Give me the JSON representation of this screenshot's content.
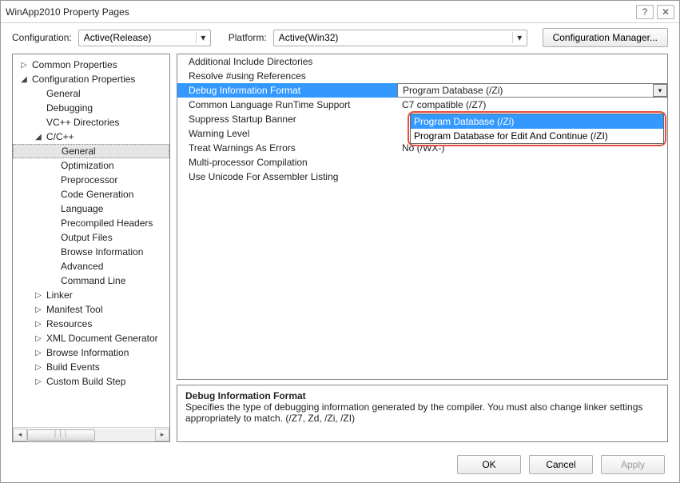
{
  "window": {
    "title": "WinApp2010 Property Pages"
  },
  "toolbar": {
    "config_label": "Configuration:",
    "config_value": "Active(Release)",
    "platform_label": "Platform:",
    "platform_value": "Active(Win32)",
    "manager_label": "Configuration Manager..."
  },
  "tree": {
    "items": [
      {
        "depth": 0,
        "exp": "▷",
        "label": "Common Properties"
      },
      {
        "depth": 0,
        "exp": "◢",
        "label": "Configuration Properties"
      },
      {
        "depth": 1,
        "exp": "",
        "label": "General"
      },
      {
        "depth": 1,
        "exp": "",
        "label": "Debugging"
      },
      {
        "depth": 1,
        "exp": "",
        "label": "VC++ Directories"
      },
      {
        "depth": 1,
        "exp": "◢",
        "label": "C/C++"
      },
      {
        "depth": 2,
        "exp": "",
        "label": "General",
        "selected": true
      },
      {
        "depth": 2,
        "exp": "",
        "label": "Optimization"
      },
      {
        "depth": 2,
        "exp": "",
        "label": "Preprocessor"
      },
      {
        "depth": 2,
        "exp": "",
        "label": "Code Generation"
      },
      {
        "depth": 2,
        "exp": "",
        "label": "Language"
      },
      {
        "depth": 2,
        "exp": "",
        "label": "Precompiled Headers"
      },
      {
        "depth": 2,
        "exp": "",
        "label": "Output Files"
      },
      {
        "depth": 2,
        "exp": "",
        "label": "Browse Information"
      },
      {
        "depth": 2,
        "exp": "",
        "label": "Advanced"
      },
      {
        "depth": 2,
        "exp": "",
        "label": "Command Line"
      },
      {
        "depth": 1,
        "exp": "▷",
        "label": "Linker"
      },
      {
        "depth": 1,
        "exp": "▷",
        "label": "Manifest Tool"
      },
      {
        "depth": 1,
        "exp": "▷",
        "label": "Resources"
      },
      {
        "depth": 1,
        "exp": "▷",
        "label": "XML Document Generator"
      },
      {
        "depth": 1,
        "exp": "▷",
        "label": "Browse Information"
      },
      {
        "depth": 1,
        "exp": "▷",
        "label": "Build Events"
      },
      {
        "depth": 1,
        "exp": "▷",
        "label": "Custom Build Step"
      }
    ]
  },
  "grid": {
    "rows": [
      {
        "name": "Additional Include Directories",
        "value": ""
      },
      {
        "name": "Resolve #using References",
        "value": ""
      },
      {
        "name": "Debug Information Format",
        "value": "Program Database (/Zi)",
        "selected": true
      },
      {
        "name": "Common Language RunTime Support",
        "value": "C7 compatible (/Z7)"
      },
      {
        "name": "Suppress Startup Banner",
        "value": ""
      },
      {
        "name": "Warning Level",
        "value": ""
      },
      {
        "name": "Treat Warnings As Errors",
        "value": "No (/WX-)"
      },
      {
        "name": "Multi-processor Compilation",
        "value": ""
      },
      {
        "name": "Use Unicode For Assembler Listing",
        "value": ""
      }
    ]
  },
  "dropdown": {
    "options": [
      {
        "label": "Program Database (/Zi)",
        "hi": true
      },
      {
        "label": "Program Database for Edit And Continue (/ZI)"
      }
    ]
  },
  "desc": {
    "title": "Debug Information Format",
    "body": "Specifies the type of debugging information generated by the compiler.  You must also change linker settings appropriately to match.     (/Z7, Zd, /Zi, /ZI)"
  },
  "footer": {
    "ok": "OK",
    "cancel": "Cancel",
    "apply": "Apply"
  }
}
